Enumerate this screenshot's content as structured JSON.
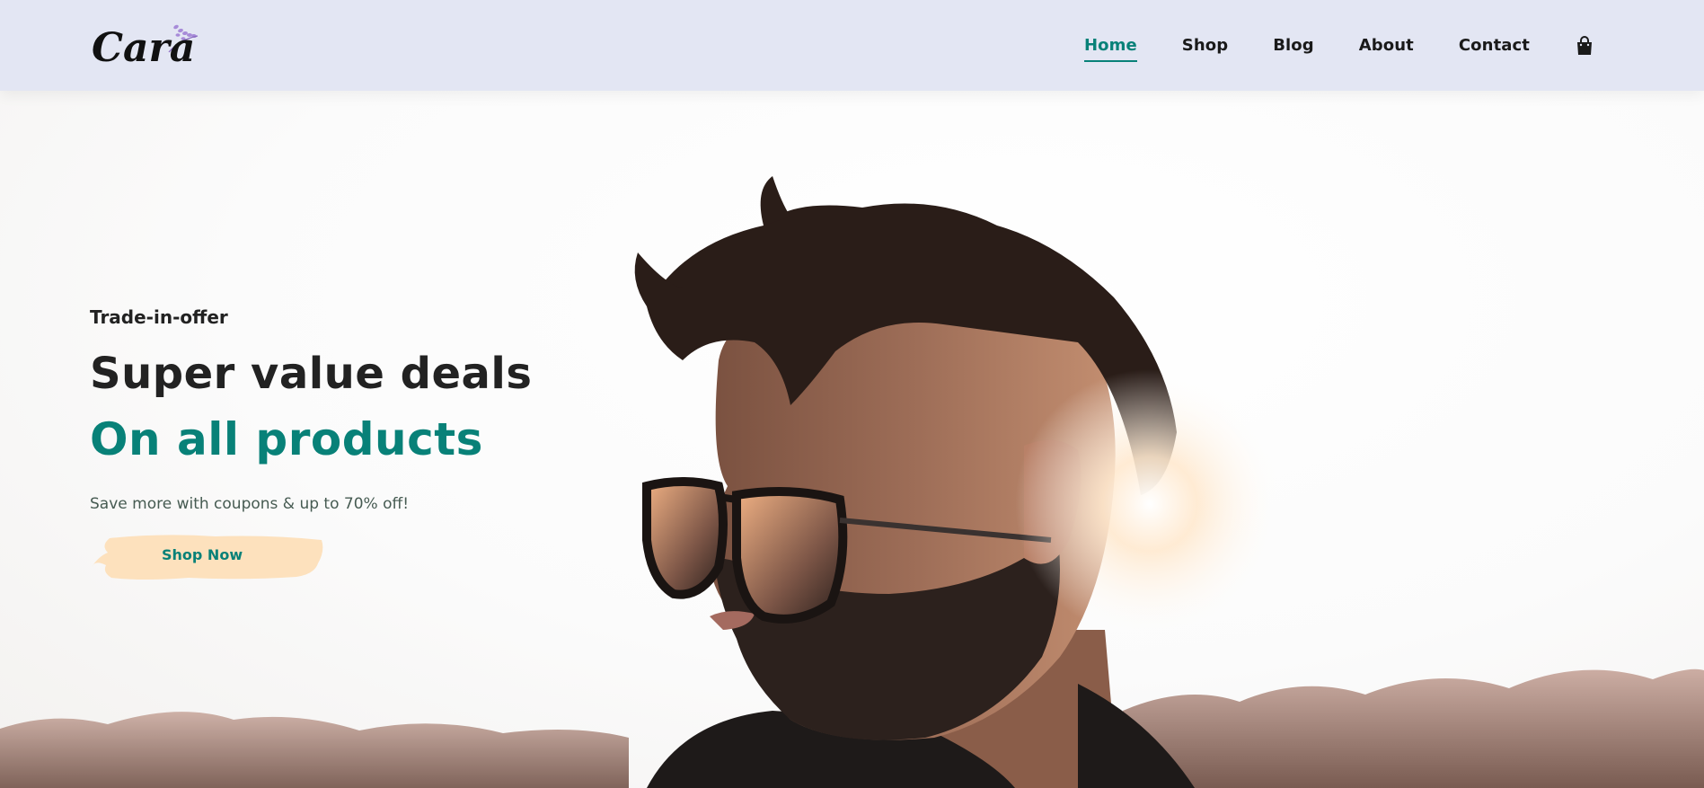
{
  "brand": {
    "name": "Cara",
    "accent": "#088178",
    "header_bg": "#e3e6f3"
  },
  "nav": {
    "items": [
      {
        "label": "Home",
        "active": true
      },
      {
        "label": "Shop",
        "active": false
      },
      {
        "label": "Blog",
        "active": false
      },
      {
        "label": "About",
        "active": false
      },
      {
        "label": "Contact",
        "active": false
      }
    ],
    "cart_icon": "shopping-bag-icon"
  },
  "hero": {
    "eyebrow": "Trade-in-offer",
    "headline": "Super value deals",
    "subheadline": "On all products",
    "tagline": "Save more with coupons & up to 70% off!",
    "cta_label": "Shop Now",
    "cta_color": "#fde1bd",
    "image": "man-with-sunglasses-photo"
  }
}
